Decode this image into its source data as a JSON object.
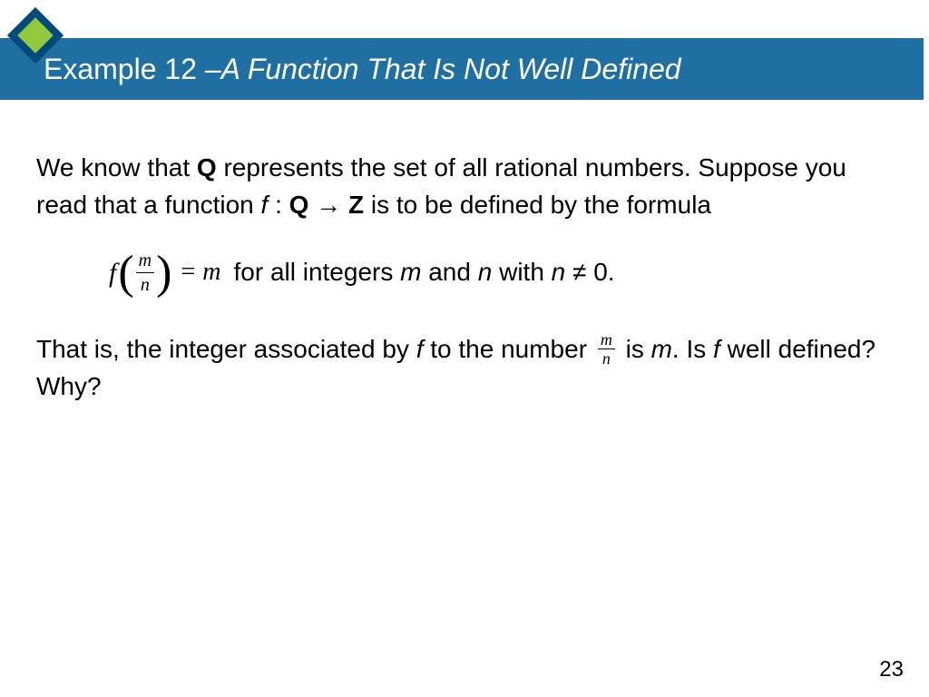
{
  "header": {
    "title_plain": "Example 12 – ",
    "title_italic": "A Function That Is Not Well Defined"
  },
  "content": {
    "p1_a": "We know that ",
    "p1_Q": "Q",
    "p1_b": " represents the set of all rational numbers. Suppose you read that a function ",
    "p1_f": "f",
    "p1_c": " : ",
    "p1_Q2": "Q",
    "p1_arrow": " → ",
    "p1_Z": "Z",
    "p1_d": " is to be defined by the formula",
    "formula": {
      "f": "f",
      "lparen": "(",
      "num": "m",
      "den": "n",
      "rparen": ")",
      "eq": "=",
      "rhs": "m"
    },
    "cond_a": "for all integers ",
    "cond_m": "m",
    "cond_b": " and ",
    "cond_n": "n",
    "cond_c": " with ",
    "cond_n2": "n",
    "cond_ne": " ≠ ",
    "cond_zero": "0.",
    "p2_a": "That is, the integer associated by ",
    "p2_f": "f",
    "p2_b": " to the number ",
    "p2_frac_num": "m",
    "p2_frac_den": "n",
    "p2_c": " is ",
    "p2_m": "m",
    "p2_d": ". Is ",
    "p2_f2": "f",
    "p2_e": " well defined? Why?"
  },
  "page_number": "23"
}
